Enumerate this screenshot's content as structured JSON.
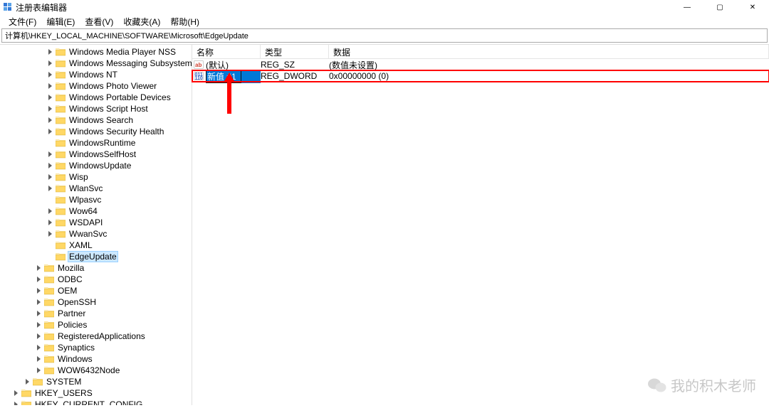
{
  "window": {
    "title": "注册表编辑器",
    "controls": {
      "min": "—",
      "max": "▢",
      "close": "✕"
    }
  },
  "menu": {
    "file": "文件(F)",
    "edit": "编辑(E)",
    "view": "查看(V)",
    "favorites": "收藏夹(A)",
    "help": "帮助(H)"
  },
  "path": "计算机\\HKEY_LOCAL_MACHINE\\SOFTWARE\\Microsoft\\EdgeUpdate",
  "tree": {
    "items": [
      {
        "indent": 64,
        "exp": "closed",
        "label": "Windows Media Player NSS"
      },
      {
        "indent": 64,
        "exp": "closed",
        "label": "Windows Messaging Subsystem"
      },
      {
        "indent": 64,
        "exp": "closed",
        "label": "Windows NT"
      },
      {
        "indent": 64,
        "exp": "closed",
        "label": "Windows Photo Viewer"
      },
      {
        "indent": 64,
        "exp": "closed",
        "label": "Windows Portable Devices"
      },
      {
        "indent": 64,
        "exp": "closed",
        "label": "Windows Script Host"
      },
      {
        "indent": 64,
        "exp": "closed",
        "label": "Windows Search"
      },
      {
        "indent": 64,
        "exp": "closed",
        "label": "Windows Security Health"
      },
      {
        "indent": 64,
        "exp": "blank",
        "label": "WindowsRuntime"
      },
      {
        "indent": 64,
        "exp": "closed",
        "label": "WindowsSelfHost"
      },
      {
        "indent": 64,
        "exp": "closed",
        "label": "WindowsUpdate"
      },
      {
        "indent": 64,
        "exp": "closed",
        "label": "Wisp"
      },
      {
        "indent": 64,
        "exp": "closed",
        "label": "WlanSvc"
      },
      {
        "indent": 64,
        "exp": "blank",
        "label": "Wlpasvc"
      },
      {
        "indent": 64,
        "exp": "closed",
        "label": "Wow64"
      },
      {
        "indent": 64,
        "exp": "closed",
        "label": "WSDAPI"
      },
      {
        "indent": 64,
        "exp": "closed",
        "label": "WwanSvc"
      },
      {
        "indent": 64,
        "exp": "blank",
        "label": "XAML"
      },
      {
        "indent": 64,
        "exp": "blank",
        "label": "EdgeUpdate",
        "selected": true
      },
      {
        "indent": 48,
        "exp": "closed",
        "label": "Mozilla"
      },
      {
        "indent": 48,
        "exp": "closed",
        "label": "ODBC"
      },
      {
        "indent": 48,
        "exp": "closed",
        "label": "OEM"
      },
      {
        "indent": 48,
        "exp": "closed",
        "label": "OpenSSH"
      },
      {
        "indent": 48,
        "exp": "closed",
        "label": "Partner"
      },
      {
        "indent": 48,
        "exp": "closed",
        "label": "Policies"
      },
      {
        "indent": 48,
        "exp": "closed",
        "label": "RegisteredApplications"
      },
      {
        "indent": 48,
        "exp": "closed",
        "label": "Synaptics"
      },
      {
        "indent": 48,
        "exp": "closed",
        "label": "Windows"
      },
      {
        "indent": 48,
        "exp": "closed",
        "label": "WOW6432Node"
      },
      {
        "indent": 32,
        "exp": "closed",
        "label": "SYSTEM"
      },
      {
        "indent": 16,
        "exp": "closed",
        "label": "HKEY_USERS"
      },
      {
        "indent": 16,
        "exp": "closed",
        "label": "HKEY_CURRENT_CONFIG"
      }
    ]
  },
  "list": {
    "columns": {
      "name": "名称",
      "type": "类型",
      "data": "数据"
    },
    "rows": [
      {
        "icon": "ab",
        "name": "(默认)",
        "type": "REG_SZ",
        "data": "(数值未设置)"
      },
      {
        "icon": "num",
        "name": "新值 #1",
        "type": "REG_DWORD",
        "data": "0x00000000 (0)",
        "editing": true,
        "highlight": true
      }
    ]
  },
  "watermark": {
    "text": "我的积木老师"
  }
}
